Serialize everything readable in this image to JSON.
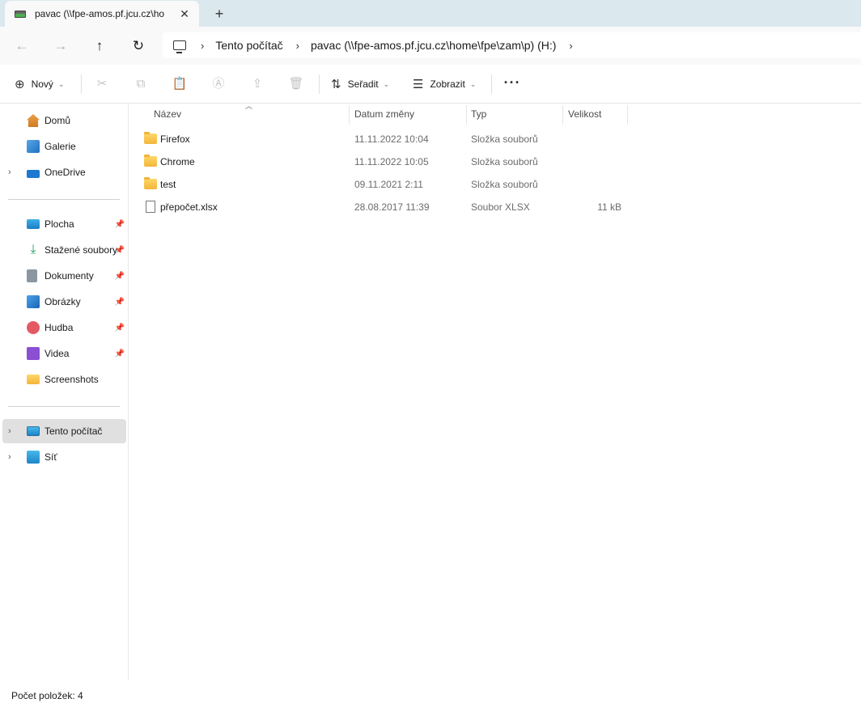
{
  "window": {
    "tab_title": "pavac (\\\\fpe-amos.pf.jcu.cz\\ho",
    "tab_close": "✕",
    "new_tab": "+"
  },
  "nav": {
    "back": "←",
    "forward": "→",
    "up": "↑",
    "refresh": "↻",
    "breadcrumb": [
      "Tento počítač",
      "pavac (\\\\fpe-amos.pf.jcu.cz\\home\\fpe\\zam\\p) (H:)"
    ],
    "sep": "›"
  },
  "toolbar": {
    "new_label": "Nový",
    "sort_label": "Seřadit",
    "view_label": "Zobrazit",
    "more": "···"
  },
  "sidebar": {
    "quick": [
      {
        "label": "Domů"
      },
      {
        "label": "Galerie"
      },
      {
        "label": "OneDrive"
      }
    ],
    "pinned": [
      {
        "label": "Plocha"
      },
      {
        "label": "Stažené soubory"
      },
      {
        "label": "Dokumenty"
      },
      {
        "label": "Obrázky"
      },
      {
        "label": "Hudba"
      },
      {
        "label": "Videa"
      },
      {
        "label": "Screenshots"
      }
    ],
    "devices": [
      {
        "label": "Tento počítač"
      },
      {
        "label": "Síť"
      }
    ],
    "chevron": "›",
    "pin": "📌"
  },
  "list": {
    "columns": {
      "name": "Název",
      "date": "Datum změny",
      "type": "Typ",
      "size": "Velikost"
    },
    "rows": [
      {
        "name": "Firefox",
        "date": "11.11.2022 10:04",
        "type": "Složka souborů",
        "size": ""
      },
      {
        "name": "Chrome",
        "date": "11.11.2022 10:05",
        "type": "Složka souborů",
        "size": ""
      },
      {
        "name": "test",
        "date": "09.11.2021 2:11",
        "type": "Složka souborů",
        "size": ""
      },
      {
        "name": "přepočet.xlsx",
        "date": "28.08.2017 11:39",
        "type": "Soubor XLSX",
        "size": "11 kB"
      }
    ]
  },
  "status": {
    "count_text": "Počet položek: 4"
  }
}
